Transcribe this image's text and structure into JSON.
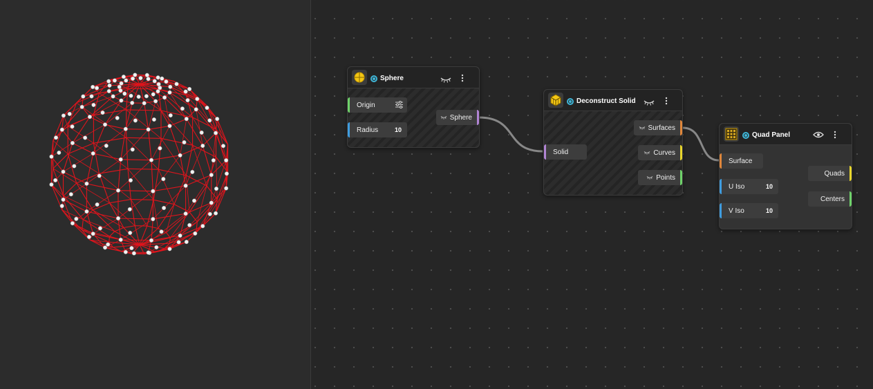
{
  "colors": {
    "wire": "#888888",
    "port_green": "#6fd36a",
    "port_blue": "#3f9de0",
    "port_purple": "#b184d4",
    "port_orange": "#e0873b",
    "port_yellow": "#e8d62c",
    "mesh": "#e0141c",
    "status": "#3fb6d8"
  },
  "nodes": {
    "sphere": {
      "title": "Sphere",
      "icon": "sphere-icon",
      "inputs": [
        {
          "label": "Origin",
          "value": "",
          "icon": "sliders-icon"
        },
        {
          "label": "Radius",
          "value": "10"
        }
      ],
      "outputs": [
        {
          "label": "Sphere"
        }
      ]
    },
    "deconstruct": {
      "title": "Deconstruct Solid",
      "icon": "cube-icon",
      "inputs": [
        {
          "label": "Solid"
        }
      ],
      "outputs": [
        {
          "label": "Surfaces"
        },
        {
          "label": "Curves"
        },
        {
          "label": "Points"
        }
      ]
    },
    "quad": {
      "title": "Quad Panel",
      "icon": "grid-panel-icon",
      "inputs": [
        {
          "label": "Surface"
        },
        {
          "label": "U Iso",
          "value": "10"
        },
        {
          "label": "V Iso",
          "value": "10"
        }
      ],
      "outputs": [
        {
          "label": "Quads"
        },
        {
          "label": "Centers"
        }
      ]
    }
  }
}
